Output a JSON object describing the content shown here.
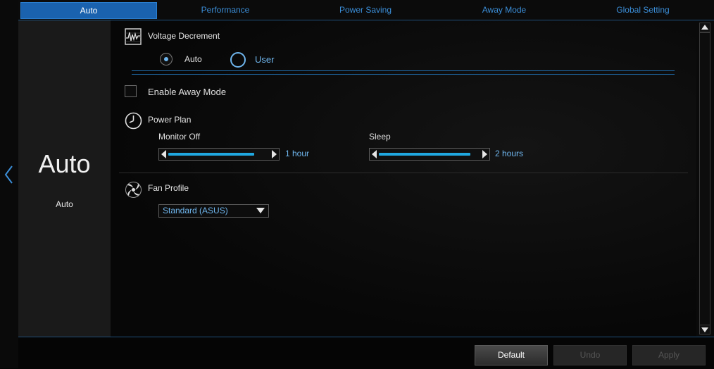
{
  "tabs": [
    "Auto",
    "Performance",
    "Power Saving",
    "Away Mode",
    "Global Setting"
  ],
  "sidebar": {
    "big_title": "Auto",
    "subtitle": "Auto"
  },
  "voltage": {
    "title": "Voltage Decrement",
    "options": [
      "Auto",
      "User"
    ],
    "selected": "Auto"
  },
  "away_mode": {
    "label": "Enable Away Mode",
    "checked": false
  },
  "power_plan": {
    "title": "Power Plan",
    "monitor_off": {
      "label": "Monitor Off",
      "value": "1 hour",
      "level": 0.85
    },
    "sleep": {
      "label": "Sleep",
      "value": "2 hours",
      "level": 0.9
    }
  },
  "fan_profile": {
    "title": "Fan Profile",
    "selected": "Standard (ASUS)"
  },
  "buttons": {
    "default": "Default",
    "undo": "Undo",
    "apply": "Apply"
  },
  "colors": {
    "accent": "#1a62ae",
    "link": "#3b8ed8",
    "value": "#6fb6ee",
    "slider": "#20a8e0"
  },
  "icons": [
    "back-chevron-icon",
    "voltage-chart-icon",
    "clock-icon",
    "fan-icon",
    "dropdown-caret-icon",
    "scroll-up-icon",
    "scroll-down-icon"
  ]
}
